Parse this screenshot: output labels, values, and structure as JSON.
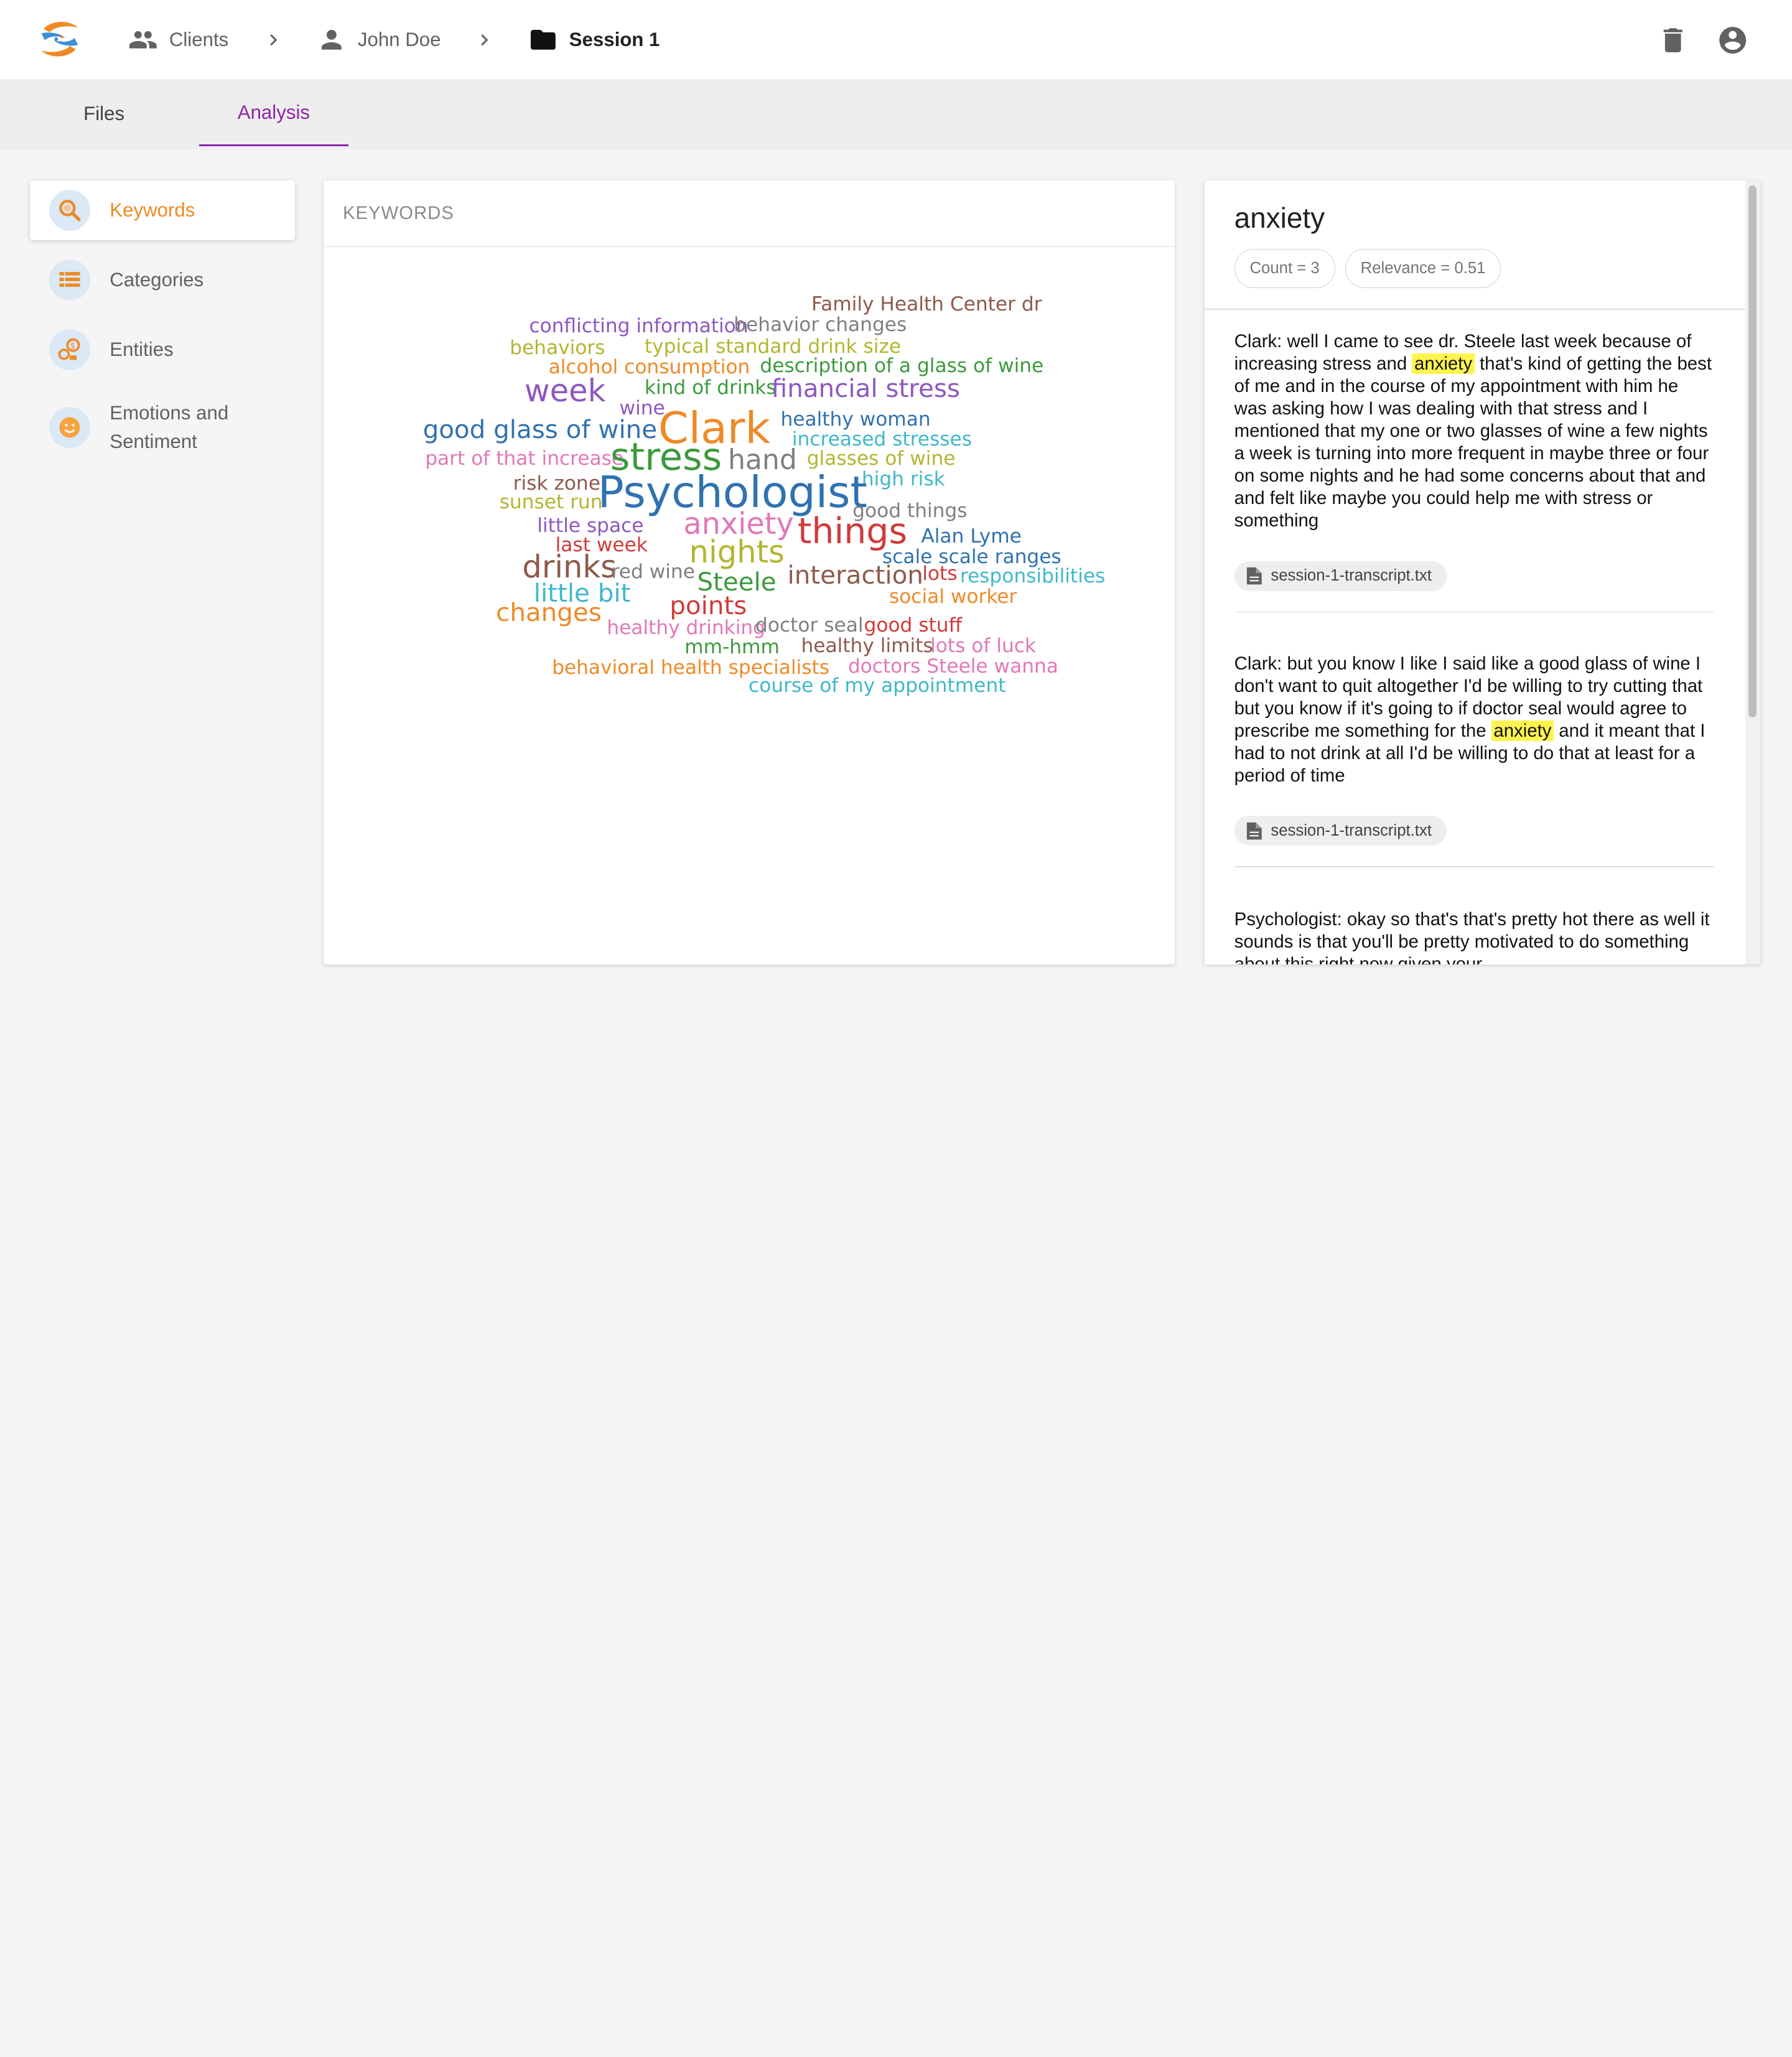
{
  "breadcrumb": {
    "clients_label": "Clients",
    "client_label": "John Doe",
    "session_label": "Session 1"
  },
  "tabs": [
    {
      "label": "Files"
    },
    {
      "label": "Analysis"
    }
  ],
  "sidenav": {
    "items": [
      {
        "label": "Keywords",
        "icon": "magnify-icon"
      },
      {
        "label": "Categories",
        "icon": "list-icon"
      },
      {
        "label": "Entities",
        "icon": "entities-icon"
      },
      {
        "label": "Emotions and Sentiment",
        "icon": "smiley-icon"
      }
    ]
  },
  "keywords_panel": {
    "header": "KEYWORDS",
    "words": [
      {
        "text": "Family Health Center dr",
        "color": "#8d5a4a"
      },
      {
        "text": "conflicting information",
        "color": "#8e57c0"
      },
      {
        "text": "behavior changes",
        "color": "#7f7f7f"
      },
      {
        "text": "behaviors",
        "color": "#b3b530"
      },
      {
        "text": "typical standard drink size",
        "color": "#b3b530"
      },
      {
        "text": "alcohol consumption",
        "color": "#ef8a26"
      },
      {
        "text": "description of a glass of wine",
        "color": "#3c9a3c"
      },
      {
        "text": "week",
        "color": "#8e57c0"
      },
      {
        "text": "kind of drinks",
        "color": "#3c9a3c"
      },
      {
        "text": "financial stress",
        "color": "#8e57c0"
      },
      {
        "text": "wine",
        "color": "#8e57c0"
      },
      {
        "text": "Clark",
        "color": "#ef8a26"
      },
      {
        "text": "healthy woman",
        "color": "#2f72b0"
      },
      {
        "text": "good glass of wine",
        "color": "#2f72b0"
      },
      {
        "text": "increased stresses",
        "color": "#3fb8c9"
      },
      {
        "text": "part of that increase",
        "color": "#e078b8"
      },
      {
        "text": "stress",
        "color": "#3c9a3c"
      },
      {
        "text": "hand",
        "color": "#7f7f7f"
      },
      {
        "text": "glasses of wine",
        "color": "#b3b530"
      },
      {
        "text": "high risk",
        "color": "#3fb8c9"
      },
      {
        "text": "risk zone",
        "color": "#8d5a4a"
      },
      {
        "text": "Psychologist",
        "color": "#2f72b0"
      },
      {
        "text": "sunset run",
        "color": "#b3b530"
      },
      {
        "text": "good things",
        "color": "#7f7f7f"
      },
      {
        "text": "little space",
        "color": "#8e57c0"
      },
      {
        "text": "anxiety",
        "color": "#e078b8"
      },
      {
        "text": "things",
        "color": "#d03a3a"
      },
      {
        "text": "Alan Lyme",
        "color": "#2f72b0"
      },
      {
        "text": "last week",
        "color": "#d03a3a"
      },
      {
        "text": "nights",
        "color": "#b3b530"
      },
      {
        "text": "scale scale ranges",
        "color": "#2f72b0"
      },
      {
        "text": "drinks",
        "color": "#8d5a4a"
      },
      {
        "text": "red wine",
        "color": "#7f7f7f"
      },
      {
        "text": "interaction",
        "color": "#8d5a4a"
      },
      {
        "text": "lots",
        "color": "#d03a3a"
      },
      {
        "text": "responsibilities",
        "color": "#3fb8c9"
      },
      {
        "text": "Steele",
        "color": "#3c9a3c"
      },
      {
        "text": "little bit",
        "color": "#3fb8c9"
      },
      {
        "text": "social worker",
        "color": "#ef8a26"
      },
      {
        "text": "points",
        "color": "#d03a3a"
      },
      {
        "text": "changes",
        "color": "#ef8a26"
      },
      {
        "text": "healthy drinking",
        "color": "#e078b8"
      },
      {
        "text": "doctor seal",
        "color": "#7f7f7f"
      },
      {
        "text": "good stuff",
        "color": "#d03a3a"
      },
      {
        "text": "mm-hmm",
        "color": "#3c9a3c"
      },
      {
        "text": "healthy limits",
        "color": "#8d5a4a"
      },
      {
        "text": "lots of luck",
        "color": "#e078b8"
      },
      {
        "text": "behavioral health specialists",
        "color": "#ef8a26"
      },
      {
        "text": "doctors Steele wanna",
        "color": "#e078b8"
      },
      {
        "text": "course of my appointment",
        "color": "#3fb8c9"
      }
    ]
  },
  "detail": {
    "title": "anxiety",
    "count_label": "Count = 3",
    "relevance_label": "Relevance = 0.51",
    "excerpts": [
      {
        "before": "Clark: well I came to see dr. Steele last week because of increasing stress and ",
        "highlight": "anxiety",
        "after": " that's kind of getting the best of me and in the course of my appointment with him he was asking how I was dealing with that stress and I mentioned that my one or two glasses of wine a few nights a week is turning into more frequent in maybe three or four on some nights and he had some concerns about that and and felt like maybe you could help me with stress or something",
        "file": "session-1-transcript.txt"
      },
      {
        "before": "Clark: but you know I like I said like a good glass of wine I don't want to quit altogether I'd be willing to try cutting that but you know if it's going to if doctor seal would agree to prescribe me something for the ",
        "highlight": "anxiety",
        "after": " and it meant that I had to not drink at all I'd be willing to do that at least for a period of time",
        "file": "session-1-transcript.txt"
      },
      {
        "before": "Psychologist: okay so that's that's pretty hot there as well it sounds is that you'll be pretty motivated to do something about this right now given your",
        "highlight": "",
        "after": "",
        "file": ""
      }
    ]
  }
}
